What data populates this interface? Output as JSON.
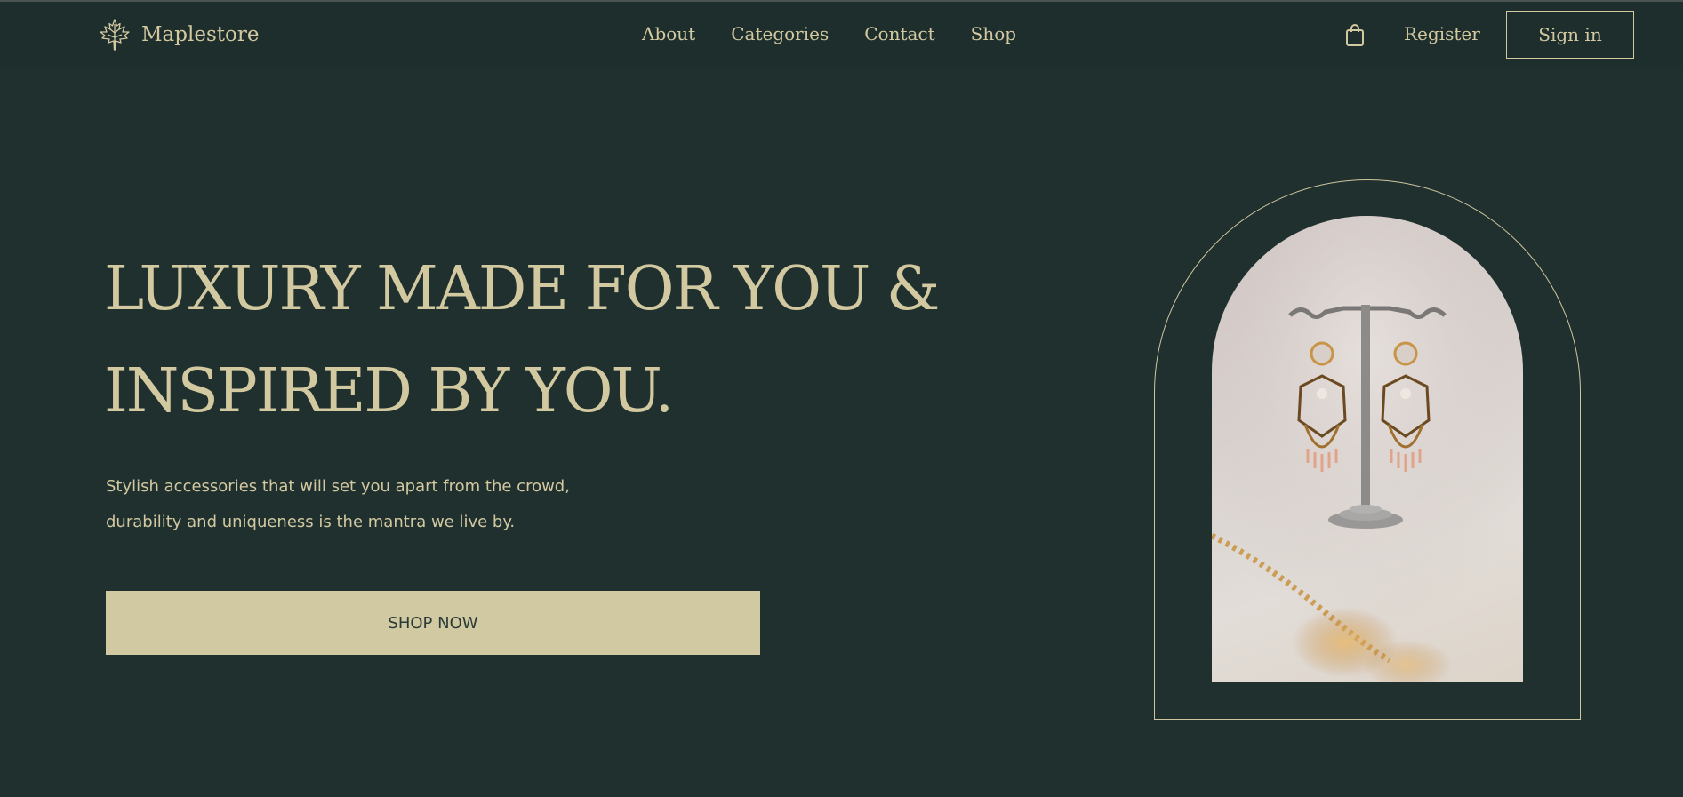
{
  "brand": {
    "name": "Maplestore",
    "logo_icon": "maple-leaf-icon"
  },
  "nav": {
    "items": [
      {
        "label": "About"
      },
      {
        "label": "Categories"
      },
      {
        "label": "Contact"
      },
      {
        "label": "Shop"
      }
    ]
  },
  "header_actions": {
    "cart_icon": "shopping-bag-icon",
    "register_label": "Register",
    "signin_label": "Sign in"
  },
  "hero": {
    "headline_line1": "LUXURY MADE FOR YOU &",
    "headline_line2": "INSPIRED BY YOU.",
    "subtext_line1": "Stylish accessories that will set you apart from the crowd,",
    "subtext_line2": "durability and uniqueness is the mantra we live by.",
    "cta_label": "SHOP NOW"
  },
  "colors": {
    "background": "#1f302f",
    "header_background": "#1d2e2c",
    "accent": "#d3c9a1",
    "button_text": "#2b3a37"
  }
}
